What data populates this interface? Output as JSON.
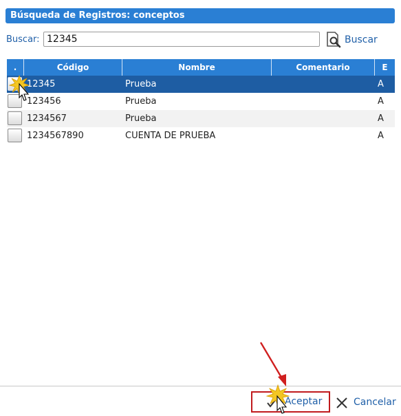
{
  "dialog": {
    "title": "Búsqueda de Registros: conceptos"
  },
  "search": {
    "label": "Buscar:",
    "value": "12345",
    "button_label": "Buscar"
  },
  "grid": {
    "columns": [
      ".",
      "Código",
      "Nombre",
      "Comentario",
      "E"
    ],
    "rows": [
      {
        "codigo": "12345",
        "nombre": "Prueba",
        "comentario": "",
        "e": "A",
        "selected": true
      },
      {
        "codigo": "123456",
        "nombre": "Prueba",
        "comentario": "",
        "e": "A",
        "selected": false
      },
      {
        "codigo": "1234567",
        "nombre": "Prueba",
        "comentario": "",
        "e": "A",
        "selected": false
      },
      {
        "codigo": "1234567890",
        "nombre": "CUENTA DE PRUEBA",
        "comentario": "",
        "e": "A",
        "selected": false
      }
    ]
  },
  "footer": {
    "accept_label": "Aceptar",
    "cancel_label": "Cancelar"
  },
  "colors": {
    "header_blue": "#2a7fd4",
    "selected_row": "#1e5da3",
    "link_blue": "#1f5fa8",
    "highlight_red": "#c0191c"
  }
}
